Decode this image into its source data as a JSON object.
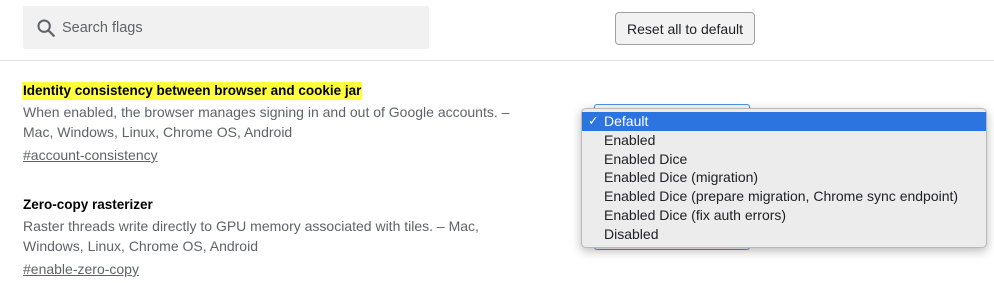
{
  "search": {
    "placeholder": "Search flags",
    "icon": "search-icon"
  },
  "toolbar": {
    "reset_label": "Reset all to default"
  },
  "flags": [
    {
      "title": "Identity consistency between browser and cookie jar",
      "description": "When enabled, the browser manages signing in and out of Google accounts. – Mac, Windows, Linux, Chrome OS, Android",
      "link": "#account-consistency",
      "highlighted": true
    },
    {
      "title": "Zero-copy rasterizer",
      "description": "Raster threads write directly to GPU memory associated with tiles. – Mac, Windows, Linux, Chrome OS, Android",
      "link": "#enable-zero-copy",
      "highlighted": false
    }
  ],
  "dropdown": {
    "check_glyph": "✓",
    "selected": "Default",
    "options": [
      "Default",
      "Enabled",
      "Enabled Dice",
      "Enabled Dice (migration)",
      "Enabled Dice (prepare migration, Chrome sync endpoint)",
      "Enabled Dice (fix auth errors)",
      "Disabled"
    ]
  },
  "colors": {
    "highlight": "#ffff3e",
    "selection": "#2c75e0",
    "secondary_text": "#5f6368"
  }
}
